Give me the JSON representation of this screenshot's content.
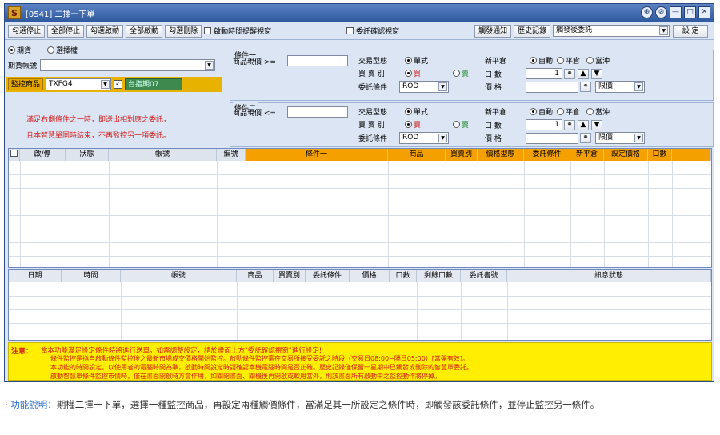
{
  "window": {
    "title": "[0541] 二擇一下單",
    "logo": "S",
    "controls": [
      "⊕",
      "⊘",
      "—",
      "□",
      "✕"
    ]
  },
  "toolbar": {
    "buttons": [
      "勾選停止",
      "全部停止",
      "勾選啟動",
      "全部啟動",
      "勾選刪除"
    ],
    "check_auto_alert": "啟動時間提醒視窗",
    "check_confirm": "委託確認視窗",
    "notify_button": "觸發通知",
    "history_button": "歷史記錄",
    "mode_select": "觸發後委託",
    "settings_button": "設  定"
  },
  "left": {
    "radio_futures": "期貨",
    "radio_options": "選擇權",
    "account_label": "期貨帳號",
    "monitor_label": "監控商品",
    "monitor_symbol": "TXFG4",
    "monitor_name": "台指期07",
    "notice_line1": "滿足右側條件之一時，即送出相對應之委託，",
    "notice_line2": "且本智慧單同時結束，不再監控另一項委託。"
  },
  "cond1": {
    "title": "條件一",
    "price_label": "商品現價 >=",
    "order_type_label": "交易型態",
    "order_type_value": "單式",
    "side_label": "買 賣 別",
    "buy": "買",
    "sell": "賣",
    "condition_label": "委託條件",
    "condition_value": "ROD",
    "offset_label": "新平倉",
    "auto": "自動",
    "close": "平倉",
    "daytrade": "當沖",
    "qty_label": "口    數",
    "qty_value": "1",
    "price2_label": "價    格",
    "price_type": "限價"
  },
  "cond2": {
    "title": "條件二",
    "price_label": "商品現價 <=",
    "order_type_label": "交易型態",
    "order_type_value": "單式",
    "side_label": "買 賣 別",
    "buy": "買",
    "sell": "賣",
    "condition_label": "委託條件",
    "condition_value": "ROD",
    "offset_label": "新平倉",
    "auto": "自動",
    "close": "平倉",
    "daytrade": "當沖",
    "qty_label": "口    數",
    "qty_value": "1",
    "price2_label": "價    格",
    "price_type": "限價"
  },
  "grid1": {
    "columns": [
      "",
      "啟/停",
      "狀態",
      "帳號",
      "編號",
      "條件一",
      "商品",
      "買賣別",
      "價格型態",
      "委託條件",
      "新平倉",
      "設定價格",
      "口數",
      ""
    ]
  },
  "grid2": {
    "columns": [
      "日期",
      "時間",
      "帳號",
      "商品",
      "買賣別",
      "委託條件",
      "價格",
      "口數",
      "剩餘口數",
      "委託書號",
      "訊息狀態"
    ]
  },
  "notes": {
    "label": "注意：",
    "line1": "當本功能滿足設定條件時將進行送單，如需調整設定，請於畫面上方\"委託確認視窗\"進行設定!",
    "line2": "條件監控是指自啟動條件監控後之最新市場成交價格開始監控。啟動條件監控需在交易所接受委託之時段（交易日08:00~隔日05:00）[當盤有效]。",
    "line3": "本功能的時間設定，以使用者的電腦時間為準，啟動時間設定時請確認本機電腦時間是否正確。歷史記錄僅保留一星期中已觸發或刪除的智慧單委託。",
    "line4": "啟動智慧單條件監控市價時，僅在畫面開啟時方會作用，如關閉畫面、關機後再開啟或軟用當外，則該畫面所有啟動中之監控動作將停掉。"
  },
  "caption": {
    "label": "功能說明：",
    "text": "期權二擇一下單，選擇一種監控商品，再設定兩種觸價條件，當滿足其一所設定之條件時，即觸發該委託條件，並停止監控另一條件。"
  }
}
